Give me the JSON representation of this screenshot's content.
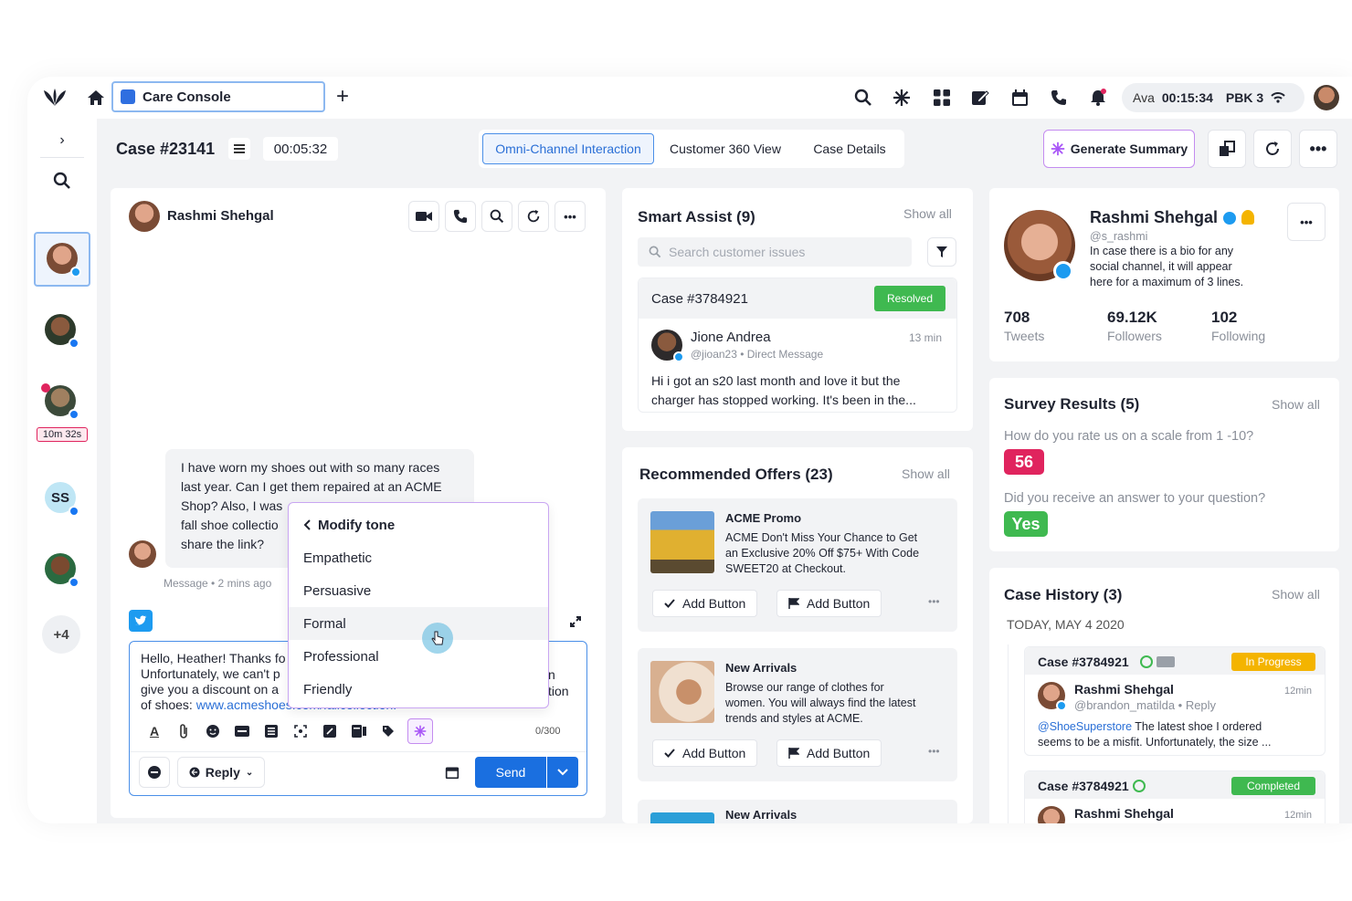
{
  "topbar": {
    "tab_title": "Care Console",
    "agent_name": "Ava",
    "timer": "00:15:34",
    "queue": "PBK 3"
  },
  "case": {
    "title": "Case #23141",
    "timer": "00:05:32",
    "tabs": [
      "Omni-Channel Interaction",
      "Customer 360 View",
      "Case Details"
    ],
    "generate_label": "Generate Summary"
  },
  "rail": {
    "timer_badge": "10m 32s",
    "ss_initials": "SS",
    "more_count": "+4"
  },
  "conversation": {
    "contact_name": "Rashmi Shehgal",
    "message_lines": [
      "I have worn my shoes out with so many races",
      "last year. Can I get them repaired at an ACME",
      "Shop? Also, I was",
      "fall shoe collectio",
      "share the link?"
    ],
    "message_meta": "Message • 2 mins ago",
    "reply_lines": [
      "Hello, Heather! Thanks fo",
      "Unfortunately, we can't p",
      "give you a discount on a",
      "of shoes: "
    ],
    "reply_link": "www.acmeshoes.com/fallcollection.",
    "reply_right_1": "n",
    "reply_right_2": "tion",
    "char_count": "0/300",
    "reply_label": "Reply",
    "send_label": "Send"
  },
  "tone_menu": {
    "title": "Modify tone",
    "options": [
      "Empathetic",
      "Persuasive",
      "Formal",
      "Professional",
      "Friendly"
    ],
    "highlighted": "Formal"
  },
  "smart_assist": {
    "title": "Smart Assist (9)",
    "show_all": "Show all",
    "search_placeholder": "Search customer issues",
    "case_id": "Case #3784921",
    "status": "Resolved",
    "author": "Jione Andrea",
    "time": "13 min",
    "handle": "@jioan23 • Direct Message",
    "text_1": "Hi i got an s20 last month and love it but the",
    "text_2": "charger has stopped working.  It's been in the..."
  },
  "offers": {
    "title": "Recommended Offers (23)",
    "show_all": "Show all",
    "items": [
      {
        "title": "ACME Promo",
        "lines": [
          "ACME Don't Miss Your Chance to Get",
          "an Exclusive 20% Off $75+ With Code",
          "SWEET20 at Checkout."
        ],
        "btn1": "Add Button",
        "btn2": "Add Button"
      },
      {
        "title": "New Arrivals",
        "lines": [
          "Browse our range of clothes for",
          "women. You will always find the latest",
          "trends and styles at ACME."
        ],
        "btn1": "Add Button",
        "btn2": "Add Button"
      },
      {
        "title": "New Arrivals"
      }
    ]
  },
  "profile": {
    "name": "Rashmi Shehgal",
    "handle": "@s_rashmi",
    "bio_lines": [
      "In case there is a bio for any",
      "social channel, it will appear",
      "here for a maximum of 3 lines."
    ],
    "stats": [
      {
        "value": "708",
        "label": "Tweets"
      },
      {
        "value": "69.12K",
        "label": "Followers"
      },
      {
        "value": "102",
        "label": "Following"
      }
    ]
  },
  "survey": {
    "title": "Survey Results (5)",
    "show_all": "Show all",
    "q1": "How do you rate us on a scale from 1 -10?",
    "a1": "56",
    "q2": "Did you receive an answer to your question?",
    "a2": "Yes"
  },
  "history": {
    "title": "Case History (3)",
    "show_all": "Show all",
    "date": "TODAY, MAY 4 2020",
    "items": [
      {
        "case": "Case #3784921",
        "status": "In Progress",
        "name": "Rashmi Shehgal",
        "time": "12min",
        "handle": "@brandon_matilda • Reply",
        "mention": "@ShoeSuperstore",
        "text_1": " The latest shoe I ordered",
        "text_2": "seems to be a misfit. Unfortunately, the size ..."
      },
      {
        "case": "Case #3784921",
        "status": "Completed",
        "name": "Rashmi Shehgal",
        "time": "12min"
      }
    ]
  },
  "colors": {
    "accent": "#0f6fde",
    "twitter": "#1d9bf0",
    "resolved": "#3fb950",
    "in_progress": "#f4b400",
    "survey_red": "#e0245e",
    "survey_green": "#3fb950",
    "purple": "#a855f7"
  }
}
